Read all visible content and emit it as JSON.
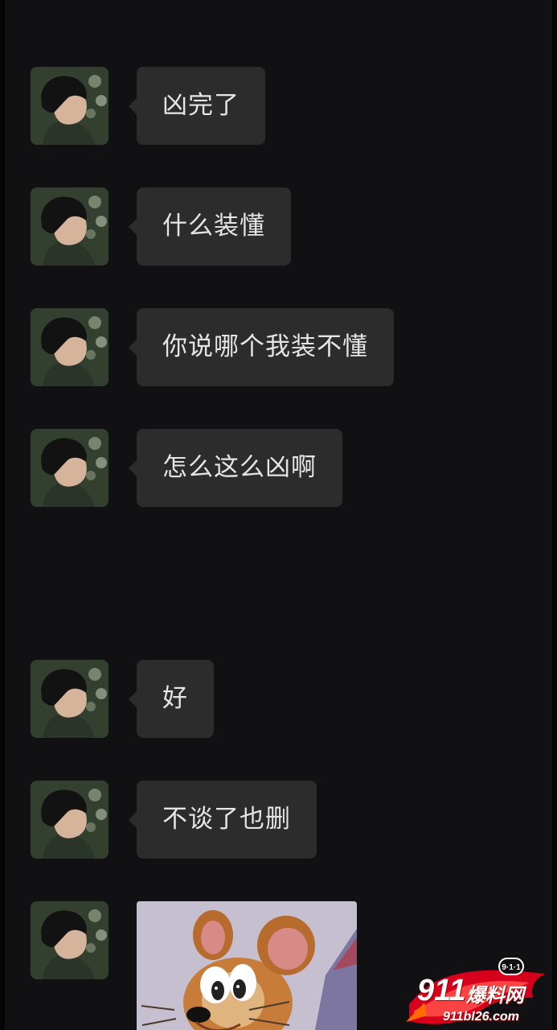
{
  "conversation": {
    "messages": [
      {
        "type": "text",
        "text": "凶完了"
      },
      {
        "type": "text",
        "text": "什么装懂"
      },
      {
        "type": "text",
        "text": "你说哪个我装不懂"
      },
      {
        "type": "text",
        "text": "怎么这么凶啊"
      },
      {
        "type": "text",
        "text": "好"
      },
      {
        "type": "text",
        "text": "不谈了也删"
      },
      {
        "type": "image",
        "sticker_icon": "cartoon-mouse-sticker"
      }
    ]
  },
  "watermark": {
    "badge": "9·1·1",
    "number": "911",
    "name": "爆料网",
    "domain": "911bl26.com"
  },
  "colors": {
    "background": "#111113",
    "bubble": "#2c2c2c",
    "text": "#e5e5e5",
    "watermark_red": "#d6001c"
  }
}
